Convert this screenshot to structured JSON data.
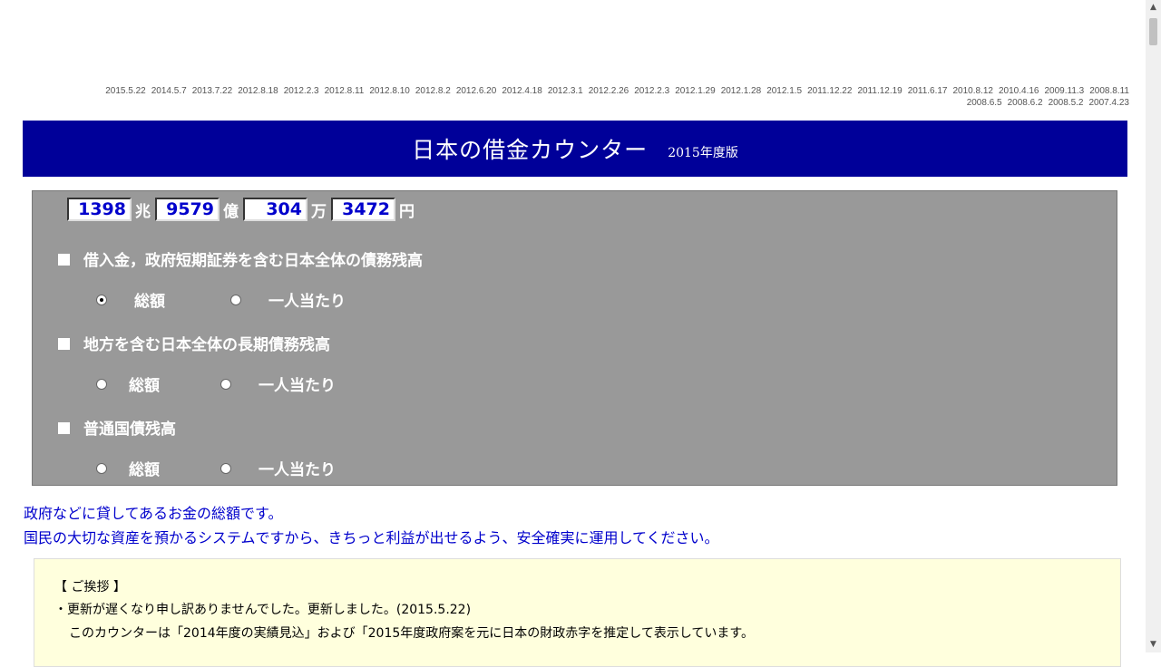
{
  "dates": {
    "row1": [
      "2015.5.22",
      "2014.5.7",
      "2013.7.22",
      "2012.8.18",
      "2012.2.3",
      "2012.8.11",
      "2012.8.10",
      "2012.8.2",
      "2012.6.20",
      "2012.4.18",
      "2012.3.1",
      "2012.2.26",
      "2012.2.3",
      "2012.1.29",
      "2012.1.28",
      "2012.1.5",
      "2011.12.22",
      "2011.12.19",
      "2011.6.17",
      "2010.8.12",
      "2010.4.16",
      "2009.11.3",
      "2008.8.11"
    ],
    "row2": [
      "2008.6.5",
      "2008.6.2",
      "2008.5.2",
      "2007.4.23"
    ]
  },
  "banner": {
    "title": "日本の借金カウンター",
    "edition": "2015年度版"
  },
  "counter": {
    "cho": "1398",
    "cho_unit": "兆",
    "oku": "9579",
    "oku_unit": "億",
    "man": "304",
    "man_unit": "万",
    "yen": "3472",
    "yen_unit": "円"
  },
  "sections": [
    {
      "label": "借入金，政府短期証券を含む日本全体の債務残高",
      "opt_total": "総額",
      "opt_per": "一人当たり",
      "selected": "total"
    },
    {
      "label": "地方を含む日本全体の長期債務残高",
      "opt_total": "総額",
      "opt_per": "一人当たり",
      "selected": "none"
    },
    {
      "label": "普通国債残高",
      "opt_total": "総額",
      "opt_per": "一人当たり",
      "selected": "none"
    }
  ],
  "description": {
    "line1": "政府などに貸してあるお金の総額です。",
    "line2": "国民の大切な資産を預かるシステムですから、きちっと利益が出せるよう、安全確実に運用してください。"
  },
  "greeting": {
    "heading": "【 ご挨拶 】",
    "line1": "・更新が遅くなり申し訳ありませんでした。更新しました。(2015.5.22)",
    "line2": "このカウンターは「2014年度の実績見込」および「2015年度政府案を元に日本の財政赤字を推定して表示しています。"
  },
  "colors": {
    "banner": "#000099",
    "panel": "#999999",
    "counter_text": "#0000cc",
    "description_text": "#0000cc",
    "greeting_bg": "#ffffdd"
  }
}
